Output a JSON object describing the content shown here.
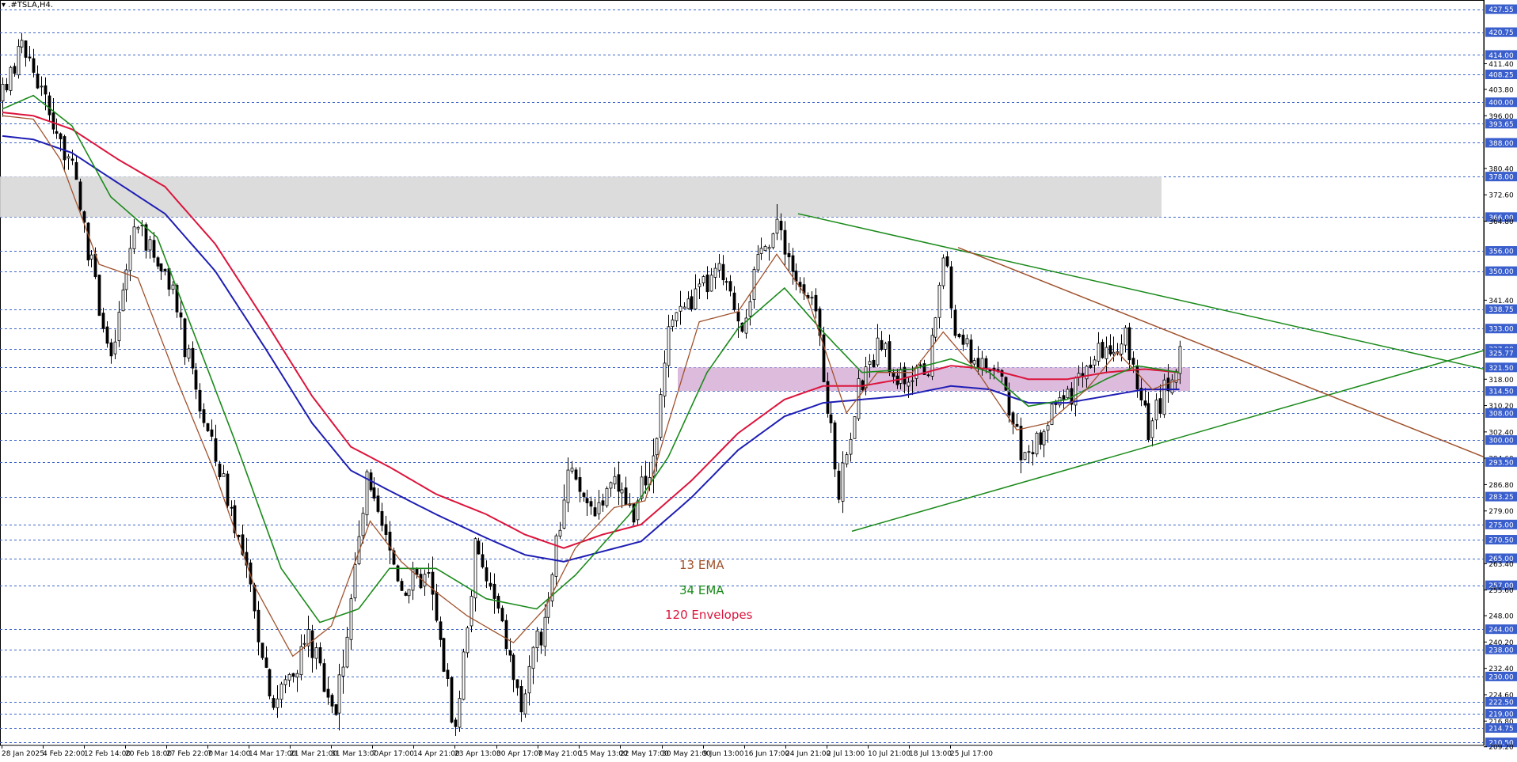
{
  "header": {
    "title": "▾ .#TSLA,H4."
  },
  "legend": [
    {
      "label": "13 EMA",
      "color": "#a0522d"
    },
    {
      "label": "34 EMA",
      "color": "#1a8a1a"
    },
    {
      "label": "120 Envelopes",
      "color": "#dc143c"
    }
  ],
  "colors": {
    "grid": "#3c64c8",
    "price_label_bg": "#3a5fcd",
    "price_label_fg": "#ffffff",
    "supply_zone": "#d8d8d8",
    "demand_zone": "#d8b4d8",
    "candle": "#000000",
    "ema13": "#a0522d",
    "ema34": "#1a8a1a",
    "env_upper": "#dc143c",
    "env_lower": "#1e1eb4",
    "trend_green": "#1a8a1a",
    "trend_brown": "#a0522d"
  },
  "chart_data": {
    "type": "candlestick",
    "symbol": "#TSLA",
    "timeframe": "H4",
    "ylim": [
      209.6,
      429.8
    ],
    "x_tick_labels": [
      "28 Jan 2025",
      "4 Feb 22:00",
      "12 Feb 14:00",
      "20 Feb 18:00",
      "27 Feb 22:00",
      "7 Mar 14:00",
      "14 Mar 17:00",
      "21 Mar 21:00",
      "31 Mar 13:00",
      "7 Apr 17:00",
      "14 Apr 21:00",
      "23 Apr 13:00",
      "30 Apr 17:00",
      "7 May 21:00",
      "15 May 13:00",
      "22 May 17:00",
      "30 May 21:00",
      "9 Jun 13:00",
      "16 Jun 17:00",
      "24 Jun 21:00",
      "2 Jul 13:00",
      "10 Jul 21:00",
      "18 Jul 13:00",
      "25 Jul 17:00"
    ],
    "y_tick_labels": [
      "427.55",
      "420.75",
      "414.00",
      "411.40",
      "408.25",
      "403.80",
      "400.00",
      "396.00",
      "393.65",
      "388.00",
      "380.40",
      "378.00",
      "372.60",
      "366.00",
      "364.80",
      "356.00",
      "350.00",
      "341.40",
      "338.75",
      "333.00",
      "327.00",
      "325.77",
      "321.50",
      "318.00",
      "314.50",
      "310.20",
      "308.00",
      "302.40",
      "300.00",
      "294.60",
      "293.50",
      "286.80",
      "283.25",
      "279.00",
      "275.00",
      "270.50",
      "265.00",
      "263.40",
      "257.00",
      "255.60",
      "248.00",
      "244.00",
      "240.20",
      "238.00",
      "232.40",
      "230.00",
      "224.60",
      "222.50",
      "219.00",
      "216.80",
      "214.75",
      "210.50",
      "209.20"
    ],
    "highlighted_prices": [
      "427.55",
      "420.75",
      "414.00",
      "408.25",
      "400.00",
      "393.65",
      "388.00",
      "378.00",
      "366.00",
      "356.00",
      "350.00",
      "338.75",
      "333.00",
      "327.00",
      "321.50",
      "314.50",
      "308.00",
      "300.00",
      "293.50",
      "283.25",
      "275.00",
      "270.50",
      "265.00",
      "257.00",
      "244.00",
      "238.00",
      "230.00",
      "222.50",
      "219.00",
      "214.75",
      "210.50"
    ],
    "current_price": "325.77",
    "zones": [
      {
        "name": "supply",
        "from": 366.0,
        "to": 378.0,
        "start": "28 Jan 2025",
        "end": "22 Jul"
      },
      {
        "name": "demand",
        "from": 314.5,
        "to": 321.5,
        "start": "7 May",
        "end": "25 Jul"
      }
    ],
    "trendlines": [
      {
        "name": "triangle-top",
        "color": "green",
        "from": [
          "26 May",
          367.0
        ],
        "to": [
          "after 25 Jul",
          321.0
        ]
      },
      {
        "name": "triangle-bottom",
        "color": "green",
        "from": [
          "2 Jun",
          273.0
        ],
        "to": [
          "after 25 Jul",
          326.0
        ]
      },
      {
        "name": "descending-resistance",
        "color": "brown",
        "from": [
          "20 Jun",
          357.0
        ],
        "to": [
          "after 25 Jul",
          295.0
        ]
      }
    ],
    "anchors": [
      [
        0,
        401
      ],
      [
        5,
        418
      ],
      [
        18,
        380
      ],
      [
        28,
        323
      ],
      [
        34,
        364
      ],
      [
        42,
        350
      ],
      [
        52,
        306
      ],
      [
        60,
        276
      ],
      [
        70,
        222
      ],
      [
        79,
        242
      ],
      [
        86,
        220
      ],
      [
        94,
        287
      ],
      [
        103,
        257
      ],
      [
        110,
        259
      ],
      [
        117,
        214
      ],
      [
        122,
        268
      ],
      [
        128,
        249
      ],
      [
        134,
        221
      ],
      [
        140,
        248
      ],
      [
        146,
        290
      ],
      [
        152,
        280
      ],
      [
        158,
        286
      ],
      [
        163,
        279
      ],
      [
        168,
        295
      ],
      [
        173,
        338
      ],
      [
        178,
        341
      ],
      [
        185,
        350
      ],
      [
        191,
        335
      ],
      [
        197,
        361
      ],
      [
        201,
        362
      ],
      [
        206,
        344
      ],
      [
        210,
        338
      ],
      [
        216,
        284
      ],
      [
        221,
        314
      ],
      [
        226,
        327
      ],
      [
        232,
        318
      ],
      [
        239,
        320
      ],
      [
        243,
        355
      ],
      [
        246,
        332
      ],
      [
        252,
        323
      ],
      [
        258,
        319
      ],
      [
        262,
        300
      ],
      [
        265,
        294
      ],
      [
        270,
        307
      ],
      [
        276,
        314
      ],
      [
        280,
        319
      ],
      [
        286,
        329
      ],
      [
        289,
        331
      ],
      [
        292,
        323
      ],
      [
        296,
        301
      ],
      [
        300,
        316
      ],
      [
        304,
        325
      ]
    ],
    "ema13_anchors": [
      [
        0,
        396
      ],
      [
        8,
        395
      ],
      [
        15,
        383
      ],
      [
        25,
        352
      ],
      [
        35,
        348
      ],
      [
        45,
        318
      ],
      [
        55,
        290
      ],
      [
        65,
        257
      ],
      [
        75,
        236
      ],
      [
        85,
        245
      ],
      [
        95,
        276
      ],
      [
        103,
        264
      ],
      [
        112,
        255
      ],
      [
        120,
        248
      ],
      [
        132,
        240
      ],
      [
        140,
        250
      ],
      [
        148,
        268
      ],
      [
        158,
        280
      ],
      [
        166,
        282
      ],
      [
        172,
        305
      ],
      [
        180,
        335
      ],
      [
        190,
        338
      ],
      [
        200,
        355
      ],
      [
        208,
        342
      ],
      [
        218,
        308
      ],
      [
        226,
        320
      ],
      [
        235,
        320
      ],
      [
        243,
        332
      ],
      [
        252,
        320
      ],
      [
        262,
        303
      ],
      [
        270,
        305
      ],
      [
        280,
        315
      ],
      [
        288,
        326
      ],
      [
        293,
        320
      ],
      [
        297,
        315
      ],
      [
        304,
        318
      ]
    ],
    "ema34_anchors": [
      [
        0,
        398
      ],
      [
        8,
        402
      ],
      [
        18,
        393
      ],
      [
        28,
        372
      ],
      [
        40,
        360
      ],
      [
        50,
        330
      ],
      [
        60,
        300
      ],
      [
        72,
        262
      ],
      [
        82,
        246
      ],
      [
        92,
        250
      ],
      [
        100,
        262
      ],
      [
        112,
        262
      ],
      [
        125,
        253
      ],
      [
        138,
        250
      ],
      [
        148,
        260
      ],
      [
        162,
        278
      ],
      [
        172,
        295
      ],
      [
        182,
        320
      ],
      [
        190,
        333
      ],
      [
        202,
        345
      ],
      [
        212,
        332
      ],
      [
        222,
        320
      ],
      [
        235,
        321
      ],
      [
        245,
        324
      ],
      [
        255,
        320
      ],
      [
        265,
        310
      ],
      [
        275,
        312
      ],
      [
        285,
        318
      ],
      [
        293,
        322
      ],
      [
        304,
        320
      ]
    ],
    "env_upper_anchors": [
      [
        0,
        397
      ],
      [
        8,
        396
      ],
      [
        18,
        392
      ],
      [
        30,
        383
      ],
      [
        42,
        375
      ],
      [
        55,
        358
      ],
      [
        68,
        335
      ],
      [
        80,
        313
      ],
      [
        90,
        298
      ],
      [
        100,
        292
      ],
      [
        112,
        284
      ],
      [
        125,
        278
      ],
      [
        135,
        272
      ],
      [
        145,
        268
      ],
      [
        155,
        272
      ],
      [
        165,
        275
      ],
      [
        178,
        288
      ],
      [
        190,
        302
      ],
      [
        202,
        312
      ],
      [
        212,
        316
      ],
      [
        222,
        316
      ],
      [
        232,
        318
      ],
      [
        245,
        322
      ],
      [
        255,
        321
      ],
      [
        265,
        318
      ],
      [
        275,
        318
      ],
      [
        285,
        320
      ],
      [
        295,
        321
      ],
      [
        304,
        320
      ]
    ],
    "env_lower_anchors": [
      [
        0,
        390
      ],
      [
        8,
        389
      ],
      [
        18,
        385
      ],
      [
        30,
        376
      ],
      [
        42,
        367
      ],
      [
        55,
        350
      ],
      [
        68,
        327
      ],
      [
        80,
        305
      ],
      [
        90,
        291
      ],
      [
        100,
        285
      ],
      [
        112,
        278
      ],
      [
        125,
        271
      ],
      [
        135,
        266
      ],
      [
        145,
        264
      ],
      [
        155,
        267
      ],
      [
        165,
        270
      ],
      [
        178,
        283
      ],
      [
        190,
        297
      ],
      [
        202,
        307
      ],
      [
        212,
        311
      ],
      [
        222,
        312
      ],
      [
        232,
        313
      ],
      [
        245,
        316
      ],
      [
        255,
        315
      ],
      [
        265,
        311
      ],
      [
        275,
        311
      ],
      [
        285,
        313
      ],
      [
        295,
        315
      ],
      [
        304,
        315
      ]
    ]
  }
}
